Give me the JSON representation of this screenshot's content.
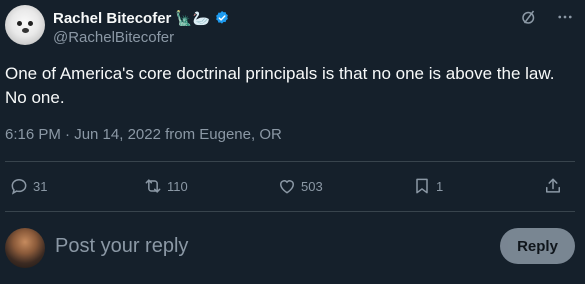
{
  "author": {
    "name": "Rachel Bitecofer",
    "emojis": "🗽🦢",
    "handle": "@RachelBitecofer"
  },
  "tweet": {
    "text": "One of America's core doctrinal principals is that no one is above the law. No one.",
    "meta": "6:16 PM · Jun 14, 2022 from Eugene, OR"
  },
  "actions": {
    "replies": "31",
    "retweets": "110",
    "likes": "503",
    "bookmarks": "1"
  },
  "reply_box": {
    "placeholder": "Post your reply",
    "button": "Reply"
  },
  "icons": {
    "top": [
      "grok-icon",
      "more-icon"
    ],
    "actions": [
      "reply-icon",
      "retweet-icon",
      "like-icon",
      "bookmark-icon",
      "share-icon"
    ]
  },
  "colors": {
    "background": "#15202b",
    "text": "#f7f9f9",
    "muted": "#8b98a5",
    "verified": "#1d9bf0"
  }
}
